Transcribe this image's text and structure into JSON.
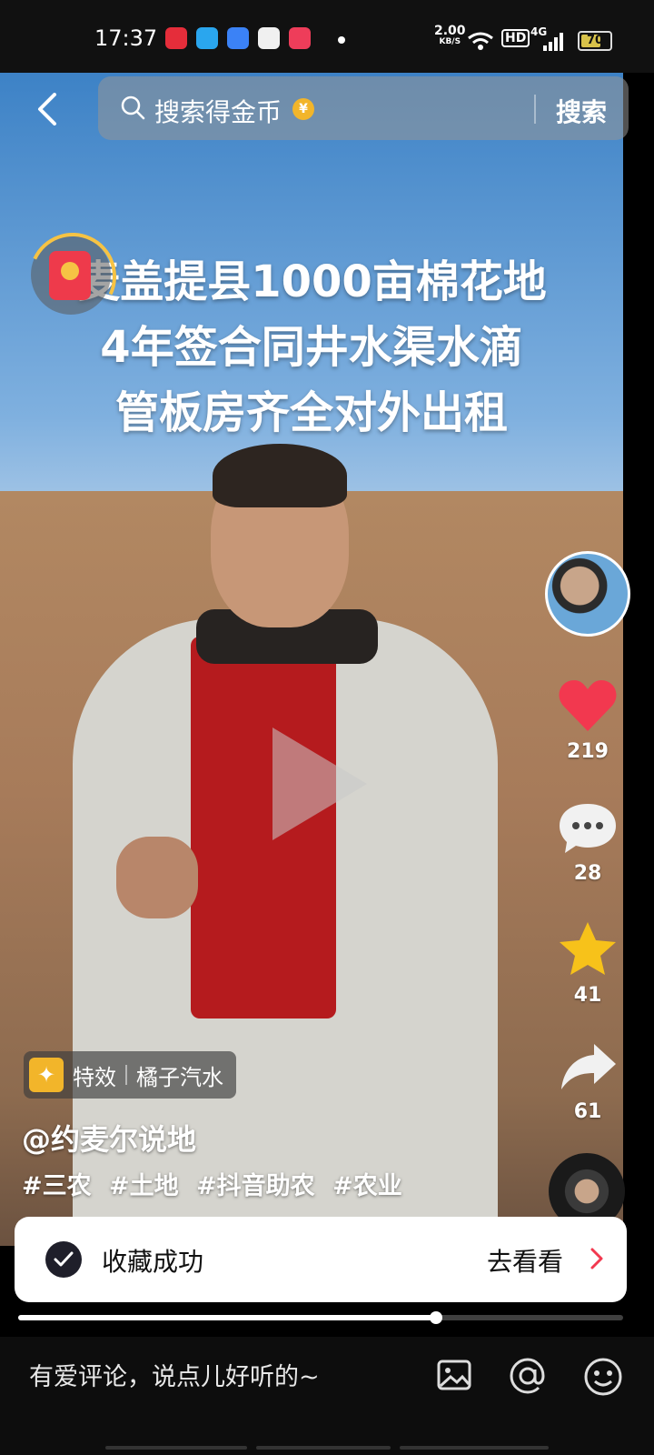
{
  "status_bar": {
    "time": "17:37",
    "net_speed": "2.00",
    "net_unit": "KB/S",
    "hd": "HD",
    "network": "4G",
    "battery": 70,
    "battery_label": "70",
    "app_icons": [
      "red-app-icon",
      "blue-app-icon",
      "cloud-app-icon",
      "color-app-icon",
      "video-app-icon"
    ]
  },
  "search": {
    "placeholder": "搜索得金币",
    "coin_symbol": "¥",
    "button": "搜索"
  },
  "video": {
    "overlay_lines": [
      "麦盖提县1000亩棉花地",
      "4年签合同井水渠水滴",
      "管板房齐全对外出租"
    ]
  },
  "actions": {
    "likes": "219",
    "comments": "28",
    "favorites": "41",
    "shares": "61"
  },
  "effect_chip": {
    "effect_label": "特效",
    "music_label": "橘子汽水"
  },
  "post": {
    "author": "@约麦尔说地",
    "hashtags": [
      "#三农",
      "#土地",
      "#抖音助农",
      "#农业"
    ]
  },
  "toast": {
    "message": "收藏成功",
    "link": "去看看"
  },
  "progress": {
    "played_fraction": 0.69
  },
  "comment_bar": {
    "placeholder": "有爱评论，说点儿好听的~"
  },
  "colors": {
    "like": "#f2384f",
    "favorite": "#f7c21a",
    "coin": "#f2b52a"
  }
}
